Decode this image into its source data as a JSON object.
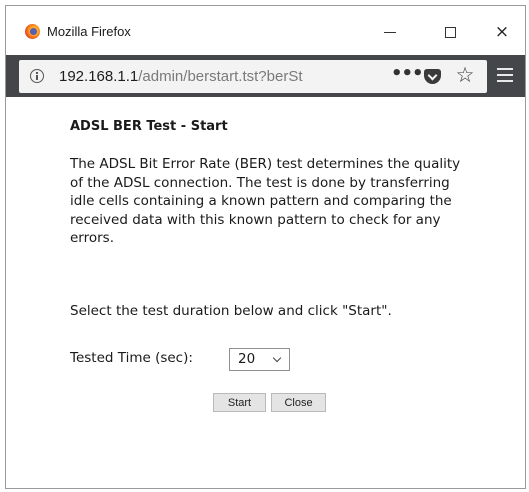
{
  "window": {
    "title": "Mozilla Firefox",
    "minimize_glyph": "",
    "close_glyph": "×"
  },
  "browser": {
    "url_host": "192.168.1.1",
    "url_path": "/admin/berstart.tst?berSt",
    "more_glyph": "•••",
    "star_glyph": "☆",
    "icons": [
      "firefox-logo",
      "site-info-icon",
      "page-actions-icon",
      "pocket-icon",
      "bookmark-star-icon",
      "menu-icon"
    ]
  },
  "page": {
    "heading": "ADSL BER Test - Start",
    "description": "The ADSL Bit Error Rate (BER) test determines the quality of the ADSL connection. The test is done by transferring idle cells containing a known pattern and comparing the received data with this known pattern to check for any errors.",
    "instruction": "Select the test duration below and click \"Start\".",
    "tested_time_label": "Tested Time (sec):",
    "tested_time_value": "20",
    "start_label": "Start",
    "close_label": "Close"
  }
}
